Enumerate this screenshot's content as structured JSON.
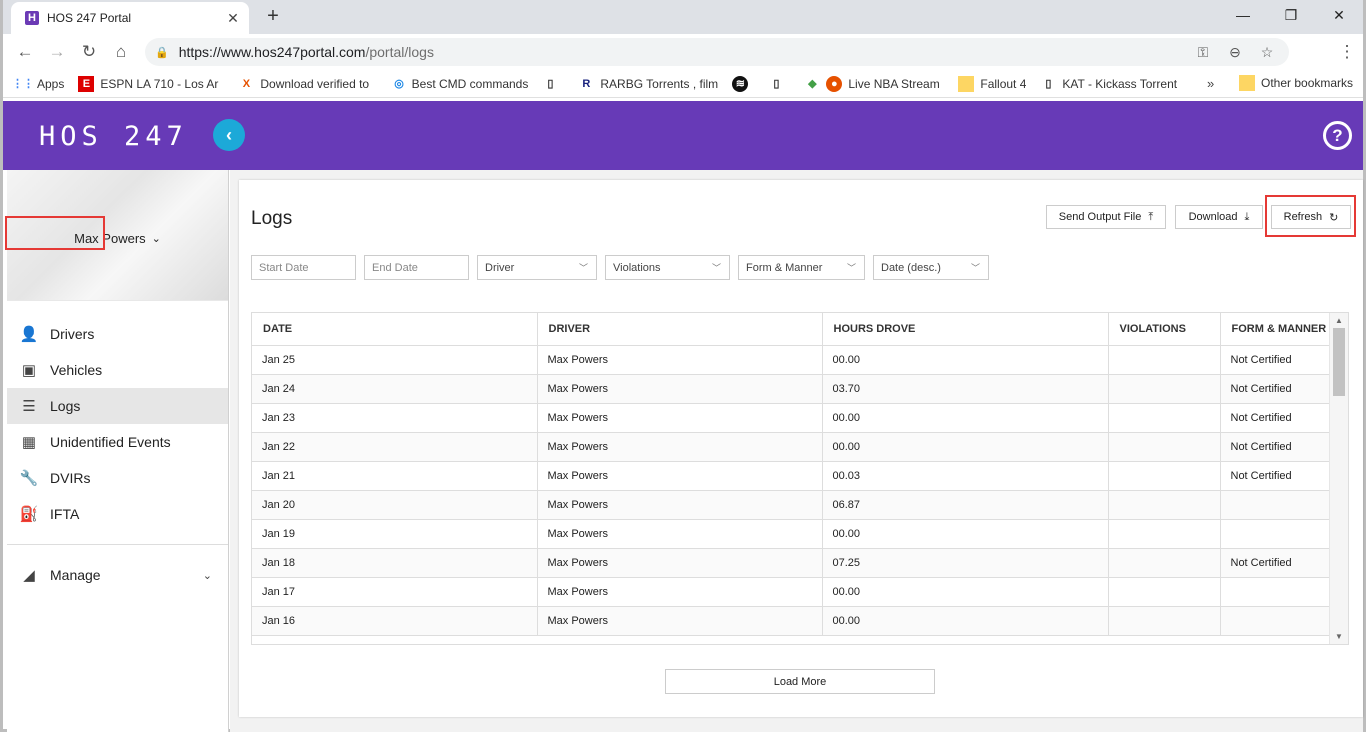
{
  "browser": {
    "tab_title": "HOS 247 Portal",
    "url_host": "https://www.hos247portal.com",
    "url_path": "/portal/logs",
    "bookmarks": [
      {
        "label": "Apps",
        "icon": "apps-grid-icon"
      },
      {
        "label": "ESPN LA 710 - Los Ar",
        "icon": "espn-icon"
      },
      {
        "label": "Download verified to",
        "icon": "x-icon"
      },
      {
        "label": "Best CMD commands",
        "icon": "spiral-icon"
      },
      {
        "label": "",
        "icon": "page-icon"
      },
      {
        "label": "RARBG Torrents , film",
        "icon": "r-icon"
      },
      {
        "label": "",
        "icon": "spotify-icon"
      },
      {
        "label": "",
        "icon": "page-icon"
      },
      {
        "label": "Live NBA Stream",
        "icon": "basketball-icon"
      },
      {
        "label": "Fallout 4",
        "icon": "folder-icon"
      },
      {
        "label": "KAT - Kickass Torrent",
        "icon": "page-icon"
      }
    ],
    "other_bookmarks": "Other bookmarks",
    "more": "»"
  },
  "app": {
    "logo": "HOS 247",
    "help": "?"
  },
  "sidebar": {
    "user_name": "Max Powers",
    "items": [
      {
        "label": "Drivers",
        "icon": "person-icon"
      },
      {
        "label": "Vehicles",
        "icon": "bus-icon"
      },
      {
        "label": "Logs",
        "icon": "list-icon"
      },
      {
        "label": "Unidentified Events",
        "icon": "calendar-icon"
      },
      {
        "label": "DVIRs",
        "icon": "wrench-icon"
      },
      {
        "label": "IFTA",
        "icon": "fuel-pump-icon"
      }
    ],
    "manage": "Manage"
  },
  "main": {
    "title": "Logs",
    "buttons": {
      "send_output": "Send Output File",
      "download": "Download",
      "refresh": "Refresh"
    },
    "filters": {
      "start_date_placeholder": "Start Date",
      "end_date_placeholder": "End Date",
      "driver": "Driver",
      "violations": "Violations",
      "form_manner": "Form & Manner",
      "sort": "Date (desc.)"
    },
    "table": {
      "headers": [
        "DATE",
        "DRIVER",
        "HOURS DROVE",
        "VIOLATIONS",
        "FORM & MANNER"
      ],
      "rows": [
        [
          "Jan 25",
          "Max Powers",
          "00.00",
          "",
          "Not Certified"
        ],
        [
          "Jan 24",
          "Max Powers",
          "03.70",
          "",
          "Not Certified"
        ],
        [
          "Jan 23",
          "Max Powers",
          "00.00",
          "",
          "Not Certified"
        ],
        [
          "Jan 22",
          "Max Powers",
          "00.00",
          "",
          "Not Certified"
        ],
        [
          "Jan 21",
          "Max Powers",
          "00.03",
          "",
          "Not Certified"
        ],
        [
          "Jan 20",
          "Max Powers",
          "06.87",
          "",
          ""
        ],
        [
          "Jan 19",
          "Max Powers",
          "00.00",
          "",
          ""
        ],
        [
          "Jan 18",
          "Max Powers",
          "07.25",
          "",
          "Not Certified"
        ],
        [
          "Jan 17",
          "Max Powers",
          "00.00",
          "",
          ""
        ],
        [
          "Jan 16",
          "Max Powers",
          "00.00",
          "",
          ""
        ]
      ]
    },
    "load_more": "Load More"
  }
}
